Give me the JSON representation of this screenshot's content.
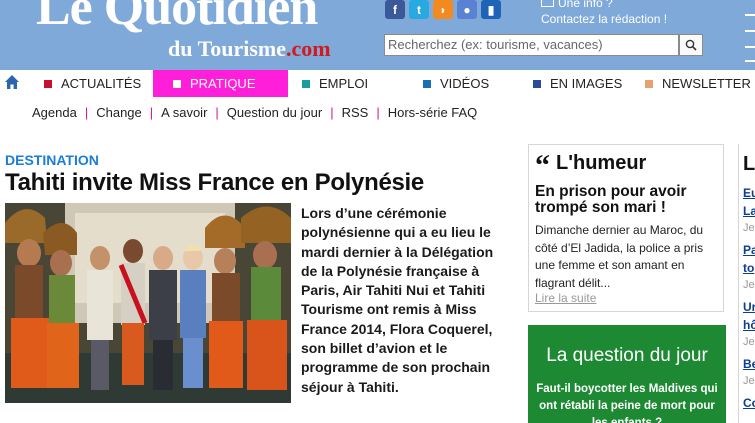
{
  "header": {
    "logo_top": "Le Quotidien",
    "logo_bottom_main": "du Tourisme",
    "logo_bottom_suffix": ".com",
    "contact_line1": "Une info ?",
    "contact_line2": "Contactez la rédaction !",
    "search_placeholder": "Recherchez (ex: tourisme, vacances)",
    "social": [
      {
        "name": "facebook-icon",
        "glyph": "f",
        "color": "#3b5998"
      },
      {
        "name": "twitter-icon",
        "glyph": "t",
        "color": "#29a9e1"
      },
      {
        "name": "rss-icon",
        "glyph": "◗",
        "color": "#f28a1f"
      },
      {
        "name": "myspace-icon",
        "glyph": "●",
        "color": "#5a82d4"
      },
      {
        "name": "mobile-icon",
        "glyph": "▮",
        "color": "#1f63b8"
      }
    ]
  },
  "nav": {
    "items": [
      {
        "label": "ACTUALITÉS",
        "color": "#c8102e"
      },
      {
        "label": "PRATIQUE",
        "color": "#ffffff",
        "active": true
      },
      {
        "label": "EMPLOI",
        "color": "#1a9c9c"
      },
      {
        "label": "VIDÉOS",
        "color": "#1a6fb0"
      },
      {
        "label": "EN IMAGES",
        "color": "#2a4a9c"
      },
      {
        "label": "NEWSLETTER",
        "color": "#e8a070"
      }
    ]
  },
  "subnav": {
    "items": [
      "Agenda",
      "Change",
      "A savoir",
      "Question du jour",
      "RSS",
      "Hors-série FAQ"
    ]
  },
  "article": {
    "kicker": "DESTINATION",
    "headline": "Tahiti invite Miss France en Polynésie",
    "lede": "Lors d’une cérémonie polynésienne qui a eu lieu le mardi dernier à la Délégation de la Polynésie française à Paris, Air Tahiti Nui et Tahiti Tourisme ont remis à Miss France 2014, Flora Coquerel, son billet d’avion et le programme de son prochain séjour à Tahiti."
  },
  "humeur": {
    "heading": "L'humeur",
    "title": "En prison pour avoir trompé son mari !",
    "text": "Dimanche dernier au Maroc, du côté d’El Jadida, la police a pris une femme et son amant en flagrant délit...",
    "more": "Lire la suite"
  },
  "question": {
    "heading": "La question du jour",
    "text": "Faut-il boycotter les Maldives qui ont rétabli la peine de mort pour les enfants ?"
  },
  "right_column": {
    "heading": "Le",
    "items": [
      {
        "title": "Eu",
        "date": "Je"
      },
      {
        "title": "La",
        "date": "Je"
      },
      {
        "title": "Pa",
        "date": "Je"
      },
      {
        "title": "to",
        "date": "Je"
      },
      {
        "title": "Ur",
        "date": "Je"
      },
      {
        "title": "hô",
        "date": "Je"
      },
      {
        "title": "Be",
        "date": "Je"
      },
      {
        "title": "Co",
        "date": "Je"
      }
    ]
  }
}
